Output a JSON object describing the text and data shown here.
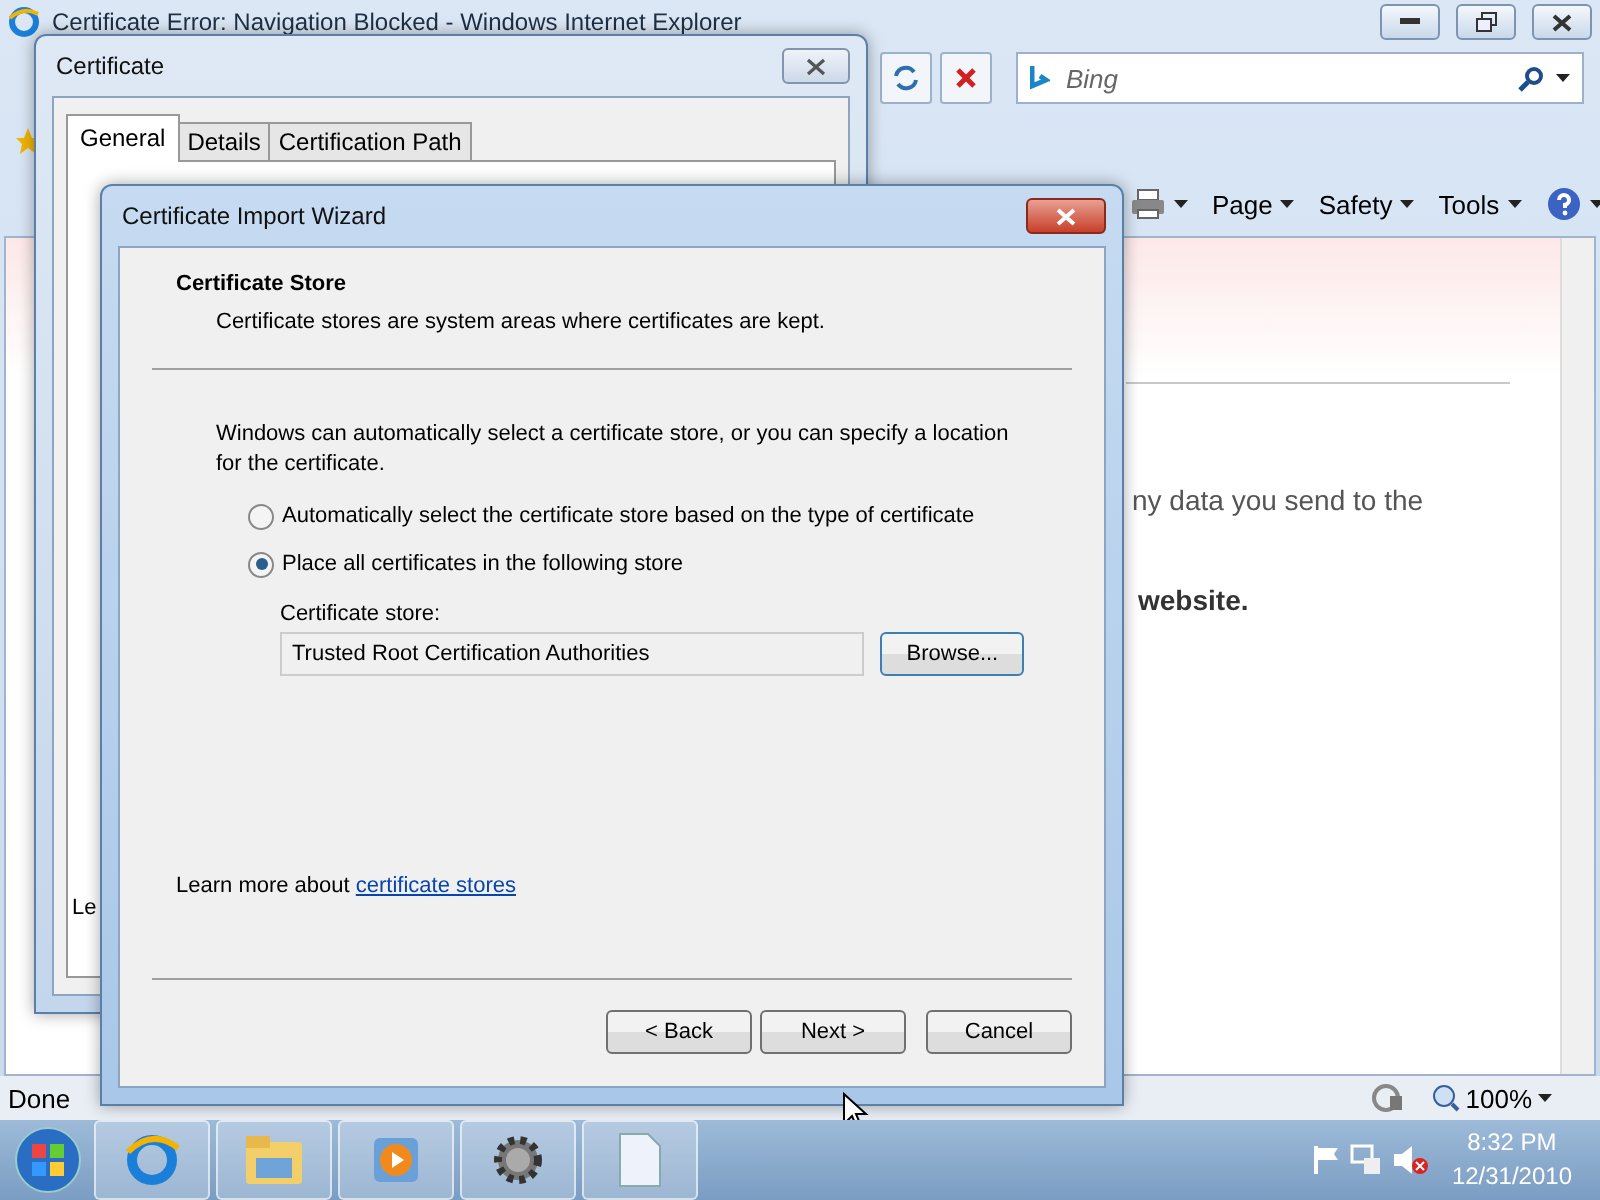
{
  "browser": {
    "title": "Certificate Error: Navigation Blocked - Windows Internet Explorer",
    "search": {
      "placeholder": "Bing"
    },
    "command_bar": [
      {
        "label": "Page"
      },
      {
        "label": "Safety"
      },
      {
        "label": "Tools"
      }
    ],
    "page_text": [
      {
        "text": "ny data you send to the",
        "bold": false
      },
      {
        "text": "website.",
        "bold": true
      }
    ],
    "status_bar": {
      "text": "Done",
      "zoom": "100%"
    }
  },
  "certificate_dialog": {
    "title": "Certificate",
    "tabs": [
      {
        "label": "General",
        "selected": true
      },
      {
        "label": "Details",
        "selected": false
      },
      {
        "label": "Certification Path",
        "selected": false
      }
    ],
    "panel_text": "Le"
  },
  "wizard": {
    "title": "Certificate Import Wizard",
    "heading": "Certificate Store",
    "subheading": "Certificate stores are system areas where certificates are kept.",
    "intro": "Windows can automatically select a certificate store, or you can specify a location for the certificate.",
    "options": [
      {
        "label": "Automatically select the certificate store based on the type of certificate",
        "selected": false
      },
      {
        "label": "Place all certificates in the following store",
        "selected": true
      }
    ],
    "store_label": "Certificate store:",
    "store_value": "Trusted Root Certification Authorities",
    "browse_button": "Browse...",
    "learn_more": {
      "text": "Learn more about",
      "link": "certificate stores"
    },
    "buttons": [
      {
        "label": "< Back"
      },
      {
        "label": "Next >"
      },
      {
        "label": "Cancel"
      }
    ]
  },
  "taskbar": {
    "time": "8:32 PM",
    "date": "12/31/2010"
  }
}
